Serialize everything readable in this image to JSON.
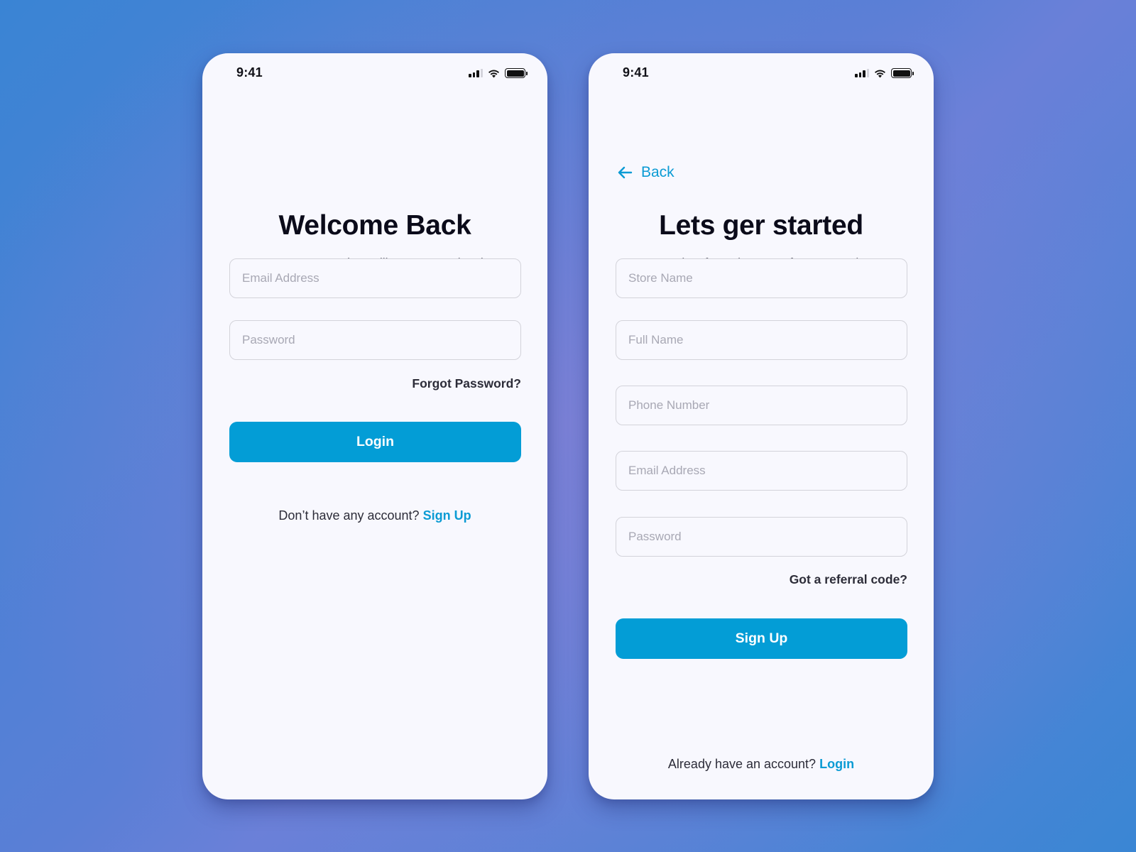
{
  "theme": {
    "accent": "#039dd6",
    "link": "#0b9bd4",
    "title_color": "#0b0b1a",
    "subtitle_color": "#6b6b78",
    "card_bg": "#f8f8fe"
  },
  "login_screen": {
    "status_bar": {
      "time": "9:41",
      "icons": [
        "cellular-signal-icon",
        "wifi-icon",
        "battery-icon"
      ]
    },
    "title": "Welcome Back",
    "subtitle": "Manage your Business like a pro, track sales.",
    "fields": [
      {
        "name": "email",
        "placeholder": "Email Address",
        "value": ""
      },
      {
        "name": "password",
        "placeholder": "Password",
        "value": ""
      }
    ],
    "forgot_password": "Forgot Password?",
    "login_button": "Login",
    "footer_text": "Don’t have any account?",
    "footer_link": "Sign Up"
  },
  "signup_screen": {
    "status_bar": {
      "time": "9:41",
      "icons": [
        "cellular-signal-icon",
        "wifi-icon",
        "battery-icon"
      ]
    },
    "back_label": "Back",
    "title": "Lets ger started",
    "subtitle": "You are only a few mins away from managing your business like a pro",
    "fields": [
      {
        "name": "store-name",
        "placeholder": "Store Name",
        "value": ""
      },
      {
        "name": "full-name",
        "placeholder": "Full Name",
        "value": ""
      },
      {
        "name": "phone-number",
        "placeholder": "Phone Number",
        "value": ""
      },
      {
        "name": "email",
        "placeholder": "Email Address",
        "value": ""
      },
      {
        "name": "password",
        "placeholder": "Password",
        "value": ""
      }
    ],
    "referral_link": "Got a referral code?",
    "signup_button": "Sign Up",
    "footer_text": "Already have an account?",
    "footer_link": "Login"
  }
}
